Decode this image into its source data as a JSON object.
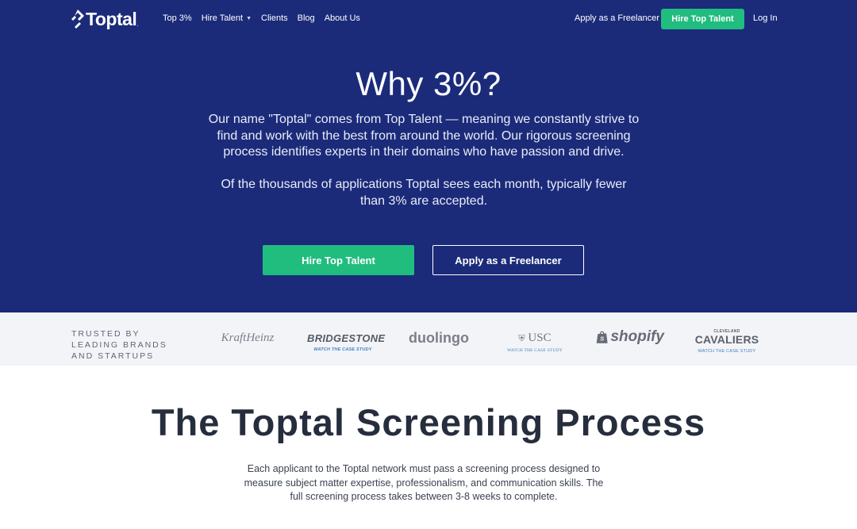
{
  "nav": {
    "logo_text": "Toptal",
    "logo_mark": ".",
    "links": [
      {
        "label": "Top 3%"
      },
      {
        "label": "Hire Talent"
      },
      {
        "label": "Clients"
      },
      {
        "label": "Blog"
      },
      {
        "label": "About Us"
      }
    ],
    "apply_label": "Apply as a Freelancer",
    "hire_button": "Hire Top Talent",
    "login": "Log In"
  },
  "hero": {
    "title": "Why 3%?",
    "paragraph1": "Our name \"Toptal\" comes from Top Talent — meaning we constantly strive to find and work with the best from around the world. Our rigorous screening process identifies experts in their domains who have passion and drive.",
    "paragraph2": "Of the thousands of applications Toptal sees each month, typically fewer than 3% are accepted.",
    "hire_button": "Hire Top Talent",
    "apply_button": "Apply as a Freelancer"
  },
  "brands": {
    "label": "TRUSTED BY LEADING BRANDS AND STARTUPS",
    "items": [
      {
        "name": "KraftHeinz",
        "cta": ""
      },
      {
        "name": "BRIDGESTONE",
        "cta": "WATCH THE CASE STUDY"
      },
      {
        "name": "duolingo",
        "cta": ""
      },
      {
        "name": "USC",
        "cta": "WATCH THE CASE STUDY"
      },
      {
        "name": "shopify",
        "cta": ""
      },
      {
        "name_small": "CLEVELAND",
        "name": "CAVALIERS",
        "cta": "WATCH THE CASE STUDY"
      }
    ]
  },
  "screening": {
    "title": "The Toptal Screening Process",
    "description": "Each applicant to the Toptal network must pass a screening process designed to measure subject matter expertise, professionalism, and communication skills. The full screening process takes between 3-8 weeks to complete."
  },
  "colors": {
    "hero_bg": "#1b2b7a",
    "accent_green": "#20bd7f",
    "brands_bg": "#f3f4f7"
  }
}
